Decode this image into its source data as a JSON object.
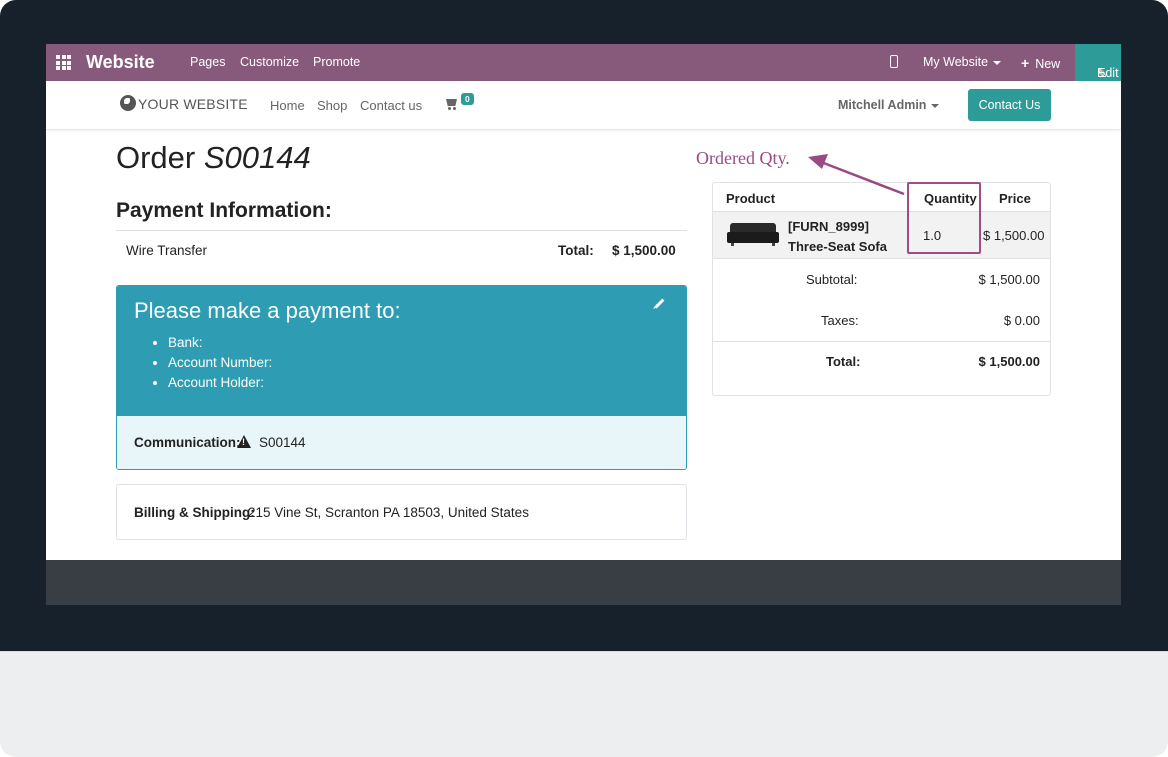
{
  "topbar": {
    "app_name": "Website",
    "menu": [
      "Pages",
      "Customize",
      "Promote"
    ],
    "site_selector": "My Website",
    "new_label": "New",
    "edit_label": "Edit",
    "background_color": "#875a7b",
    "edit_color": "#2d9c98"
  },
  "navbar": {
    "logo_text": "YOUR WEBSITE",
    "links": [
      "Home",
      "Shop",
      "Contact us"
    ],
    "cart_count": "0",
    "user_name": "Mitchell Admin",
    "contact_button": "Contact Us"
  },
  "order": {
    "title_prefix": "Order",
    "order_number": "S00144"
  },
  "payment_info": {
    "heading": "Payment Information:",
    "method": "Wire Transfer",
    "total_label": "Total:",
    "total_value": "$ 1,500.00"
  },
  "payment_box": {
    "heading": "Please make a payment to:",
    "items": [
      "Bank:",
      "Account Number:",
      "Account Holder:"
    ],
    "communication_label": "Communication:",
    "communication_value": "S00144",
    "color": "#2e9cb2"
  },
  "billing": {
    "label": "Billing & Shipping:",
    "address": "215 Vine St, Scranton PA 18503, United States"
  },
  "summary": {
    "headers": {
      "product": "Product",
      "quantity": "Quantity",
      "price": "Price"
    },
    "product_name": "[FURN_8999] Three-Seat Sofa",
    "quantity": "1.0",
    "price": "$ 1,500.00",
    "subtotal_label": "Subtotal:",
    "subtotal_value": "$ 1,500.00",
    "taxes_label": "Taxes:",
    "taxes_value": "$ 0.00",
    "total_label": "Total:",
    "total_value": "$ 1,500.00"
  },
  "annotation": {
    "text": "Ordered Qty.",
    "color": "#9a4a82"
  }
}
